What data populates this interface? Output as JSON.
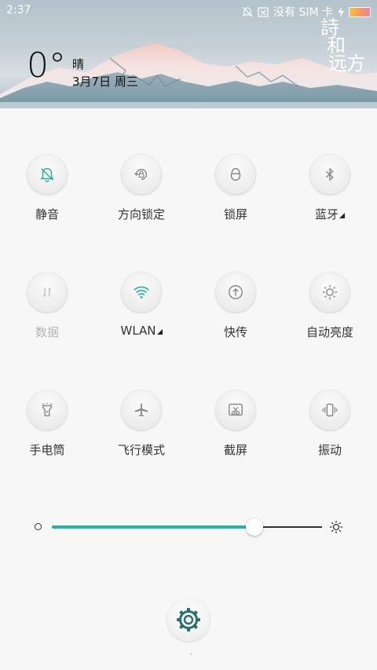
{
  "status_bar": {
    "time": "2:37",
    "carrier": "没有 SIM 卡",
    "icons": [
      "bell-off-icon",
      "sim-x-icon",
      "charging-icon",
      "battery-icon"
    ]
  },
  "weather": {
    "temperature": "0°",
    "condition": "晴",
    "date": "3月7日 周三"
  },
  "wallpaper_text": {
    "c1": "詩",
    "c2": "和",
    "c3": "远",
    "c4": "方"
  },
  "toggles": [
    {
      "label": "静音",
      "icon": "bell-off-icon",
      "active": true
    },
    {
      "label": "方向锁定",
      "icon": "rotation-lock-icon",
      "active": false
    },
    {
      "label": "锁屏",
      "icon": "lock-icon",
      "active": false
    },
    {
      "label": "蓝牙",
      "icon": "bluetooth-icon",
      "active": false,
      "has_submenu": true
    },
    {
      "label": "数据",
      "icon": "mobile-data-icon",
      "active": false,
      "disabled": true
    },
    {
      "label": "WLAN",
      "icon": "wifi-icon",
      "active": true,
      "has_submenu": true
    },
    {
      "label": "快传",
      "icon": "quick-transfer-icon",
      "active": false
    },
    {
      "label": "自动亮度",
      "icon": "auto-brightness-icon",
      "active": false
    },
    {
      "label": "手电筒",
      "icon": "flashlight-icon",
      "active": false
    },
    {
      "label": "飞行模式",
      "icon": "airplane-icon",
      "active": false
    },
    {
      "label": "截屏",
      "icon": "screenshot-icon",
      "active": false
    },
    {
      "label": "振动",
      "icon": "vibrate-icon",
      "active": false
    }
  ],
  "brightness": {
    "level": 0.75
  },
  "colors": {
    "accent": "#29b0a6",
    "inactive_icon": "#8a8a8a"
  }
}
